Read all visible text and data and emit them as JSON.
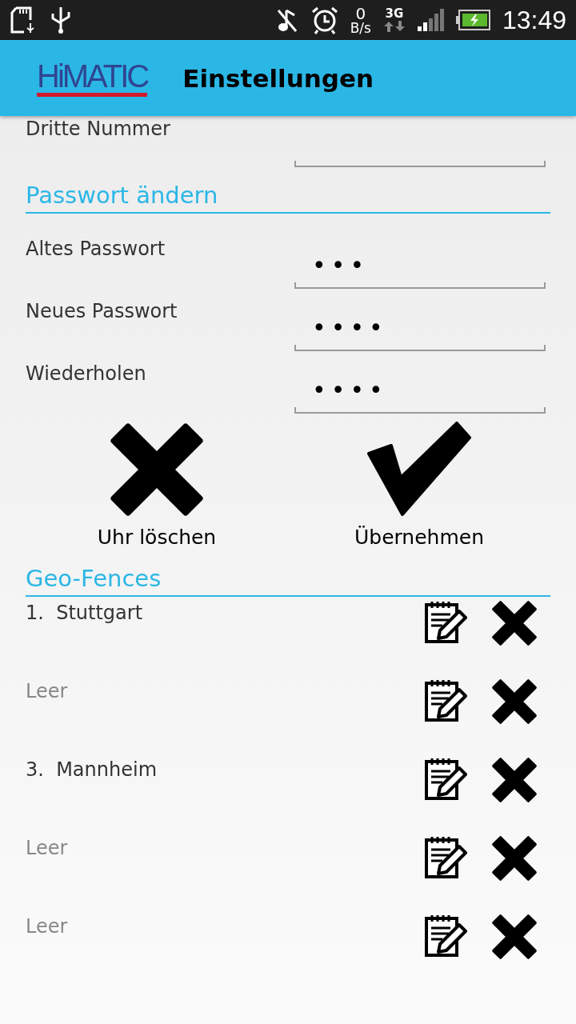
{
  "status_bar": {
    "net_rate": "0",
    "net_unit": "B/s",
    "network": "3G",
    "time": "13:49"
  },
  "app_bar": {
    "logo": "HiMATIC",
    "title": "Einstellungen"
  },
  "top_field": {
    "label": "Dritte Nummer"
  },
  "password_section": {
    "title": "Passwort ändern",
    "fields": [
      {
        "label": "Altes Passwort",
        "value": "•••"
      },
      {
        "label": "Neues Passwort",
        "value": "••••"
      },
      {
        "label": "Wiederholen",
        "value": "••••"
      }
    ]
  },
  "actions": [
    {
      "kind": "delete",
      "label": "Uhr löschen"
    },
    {
      "kind": "confirm",
      "label": "Übernehmen"
    }
  ],
  "geo_section": {
    "title": "Geo-Fences",
    "items": [
      {
        "text": "1.  Stuttgart",
        "empty": false
      },
      {
        "text": "Leer",
        "empty": true
      },
      {
        "text": "3.  Mannheim",
        "empty": false
      },
      {
        "text": "Leer",
        "empty": true
      },
      {
        "text": "Leer",
        "empty": true
      }
    ]
  }
}
